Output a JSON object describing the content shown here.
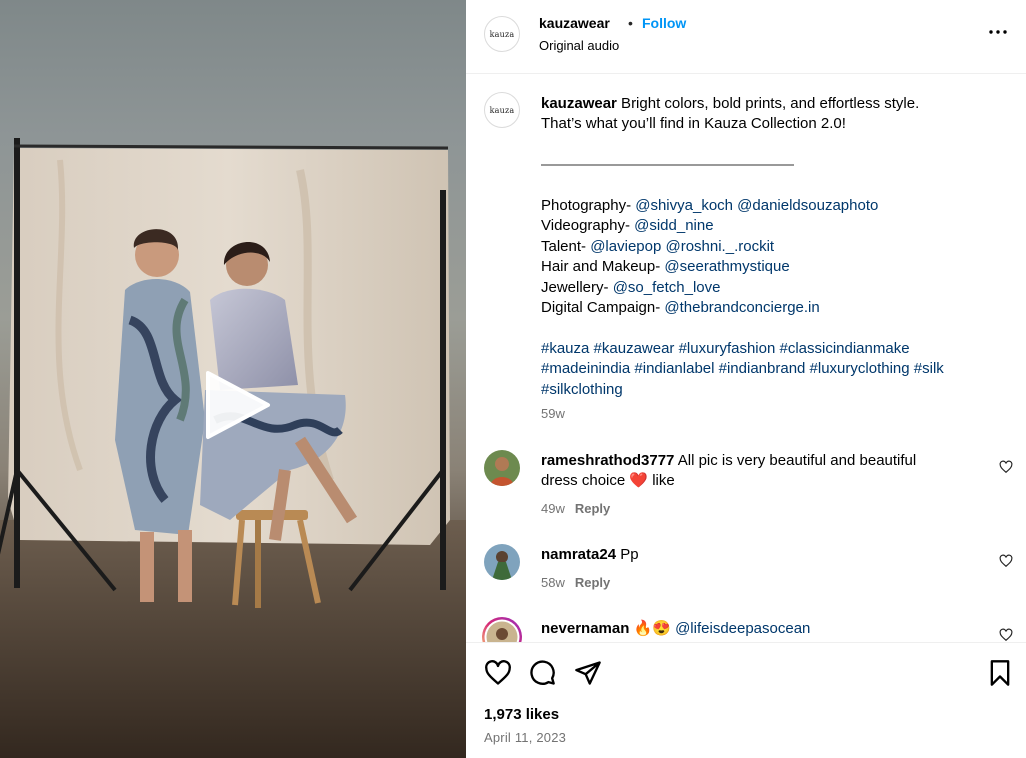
{
  "media": {
    "play_icon": "play-icon"
  },
  "header": {
    "avatar_text": "kauza",
    "username": "kauzawear",
    "separator": "•",
    "follow_label": "Follow",
    "subtitle": "Original audio",
    "more_icon": "more-options-icon"
  },
  "caption": {
    "avatar_text": "kauza",
    "username": "kauzawear",
    "text_line1": " Bright colors, bold prints, and effortless style.",
    "text_line2": "That’s what you’ll find in Kauza Collection 2.0!",
    "divider": "——————————————————",
    "credits": [
      {
        "role": "Photography- ",
        "mentions": "@shivya_koch @danieldsouzaphoto"
      },
      {
        "role": "Videography- ",
        "mentions": "@sidd_nine"
      },
      {
        "role": "Talent- ",
        "mentions": "@laviepop @roshni._.rockit"
      },
      {
        "role": "Hair and Makeup- ",
        "mentions": "@seerathmystique"
      },
      {
        "role": "Jewellery- ",
        "mentions": "@so_fetch_love"
      },
      {
        "role": "Digital Campaign- ",
        "mentions": "@thebrandconcierge.in"
      }
    ],
    "hashtags_line1": "#kauza #kauzawear #luxuryfashion #classicindianmake",
    "hashtags_line2": "#madeinindia #indianlabel #indianbrand #luxuryclothing #silk",
    "hashtags_line3": "#silkclothing",
    "time": "59w"
  },
  "comments": [
    {
      "username": "rameshrathod3777",
      "text": " All pic is very beautiful and beautiful",
      "text2": "dress choice ❤️ like",
      "time": "49w",
      "reply": "Reply"
    },
    {
      "username": "namrata24",
      "text": " Pp",
      "time": "58w",
      "reply": "Reply"
    },
    {
      "username": "nevernaman",
      "text": " 🔥😍 ",
      "mention": "@lifeisdeepasocean"
    }
  ],
  "actions": {
    "like_icon": "heart-icon",
    "comment_icon": "comment-icon",
    "share_icon": "share-icon",
    "save_icon": "bookmark-icon",
    "likes": "1,973 likes",
    "date": "April 11, 2023"
  },
  "colors": {
    "link": "#00376b",
    "follow": "#0095f6",
    "muted": "#737373"
  }
}
